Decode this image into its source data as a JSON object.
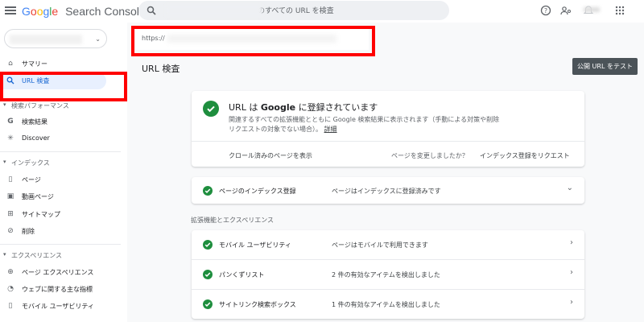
{
  "header": {
    "logo_google": [
      "G",
      "o",
      "o",
      "g",
      "l",
      "e"
    ],
    "logo_product": "Search Console",
    "search_placeholder": "のすべての URL を検査"
  },
  "sidebar": {
    "items": [
      {
        "label": "サマリー",
        "icon": "home-icon"
      },
      {
        "label": "URL 検査",
        "icon": "search-icon",
        "active": true
      }
    ],
    "performance_section": "検索パフォーマンス",
    "performance_items": [
      {
        "label": "検索結果",
        "icon": "google-g-icon"
      },
      {
        "label": "Discover",
        "icon": "asterisk-icon"
      }
    ],
    "index_section": "インデックス",
    "index_items": [
      {
        "label": "ページ",
        "icon": "page-icon"
      },
      {
        "label": "動画ページ",
        "icon": "video-page-icon"
      },
      {
        "label": "サイトマップ",
        "icon": "sitemap-icon"
      },
      {
        "label": "削除",
        "icon": "remove-icon"
      }
    ],
    "experience_section": "エクスペリエンス",
    "experience_items": [
      {
        "label": "ページ エクスペリエンス",
        "icon": "plus-circle-icon"
      },
      {
        "label": "ウェブに関する主な指標",
        "icon": "gauge-icon"
      },
      {
        "label": "モバイル ユーザビリティ",
        "icon": "phone-icon"
      }
    ]
  },
  "main": {
    "url_prefix": "https://",
    "page_title": "URL 検査",
    "test_button": "公開 URL をテスト",
    "status": {
      "title_prefix": "URL は ",
      "title_bold": "Google",
      "title_suffix": " に登録されています",
      "description": "関連するすべての拡張機能とともに Google 検索結果に表示されます（手動による対策や削除リクエストの対象でない場合）。",
      "more_link": "詳細",
      "crawled_link": "クロール済みのページを表示",
      "changed_question": "ページを変更しましたか？",
      "request_indexing": "インデックス登録をリクエスト"
    },
    "index_row": {
      "name": "ページのインデックス登録",
      "value": "ページはインデックスに登録済みです",
      "arrow": "⌄"
    },
    "enhancements_label": "拡張機能とエクスペリエンス",
    "enhancement_rows": [
      {
        "name": "モバイル ユーザビリティ",
        "value": "ページはモバイルで利用できます",
        "arrow": "›"
      },
      {
        "name": "パンくずリスト",
        "value": "2 件の有効なアイテムを検出しました",
        "arrow": "›"
      },
      {
        "name": "サイトリンク検索ボックス",
        "value": "1 件の有効なアイテムを検出しました",
        "arrow": "›"
      }
    ]
  },
  "colors": {
    "accent_blue": "#1967d2",
    "active_bg": "#e8f0fe",
    "success_green": "#1e8e3e",
    "highlight_red": "#ff0000"
  }
}
